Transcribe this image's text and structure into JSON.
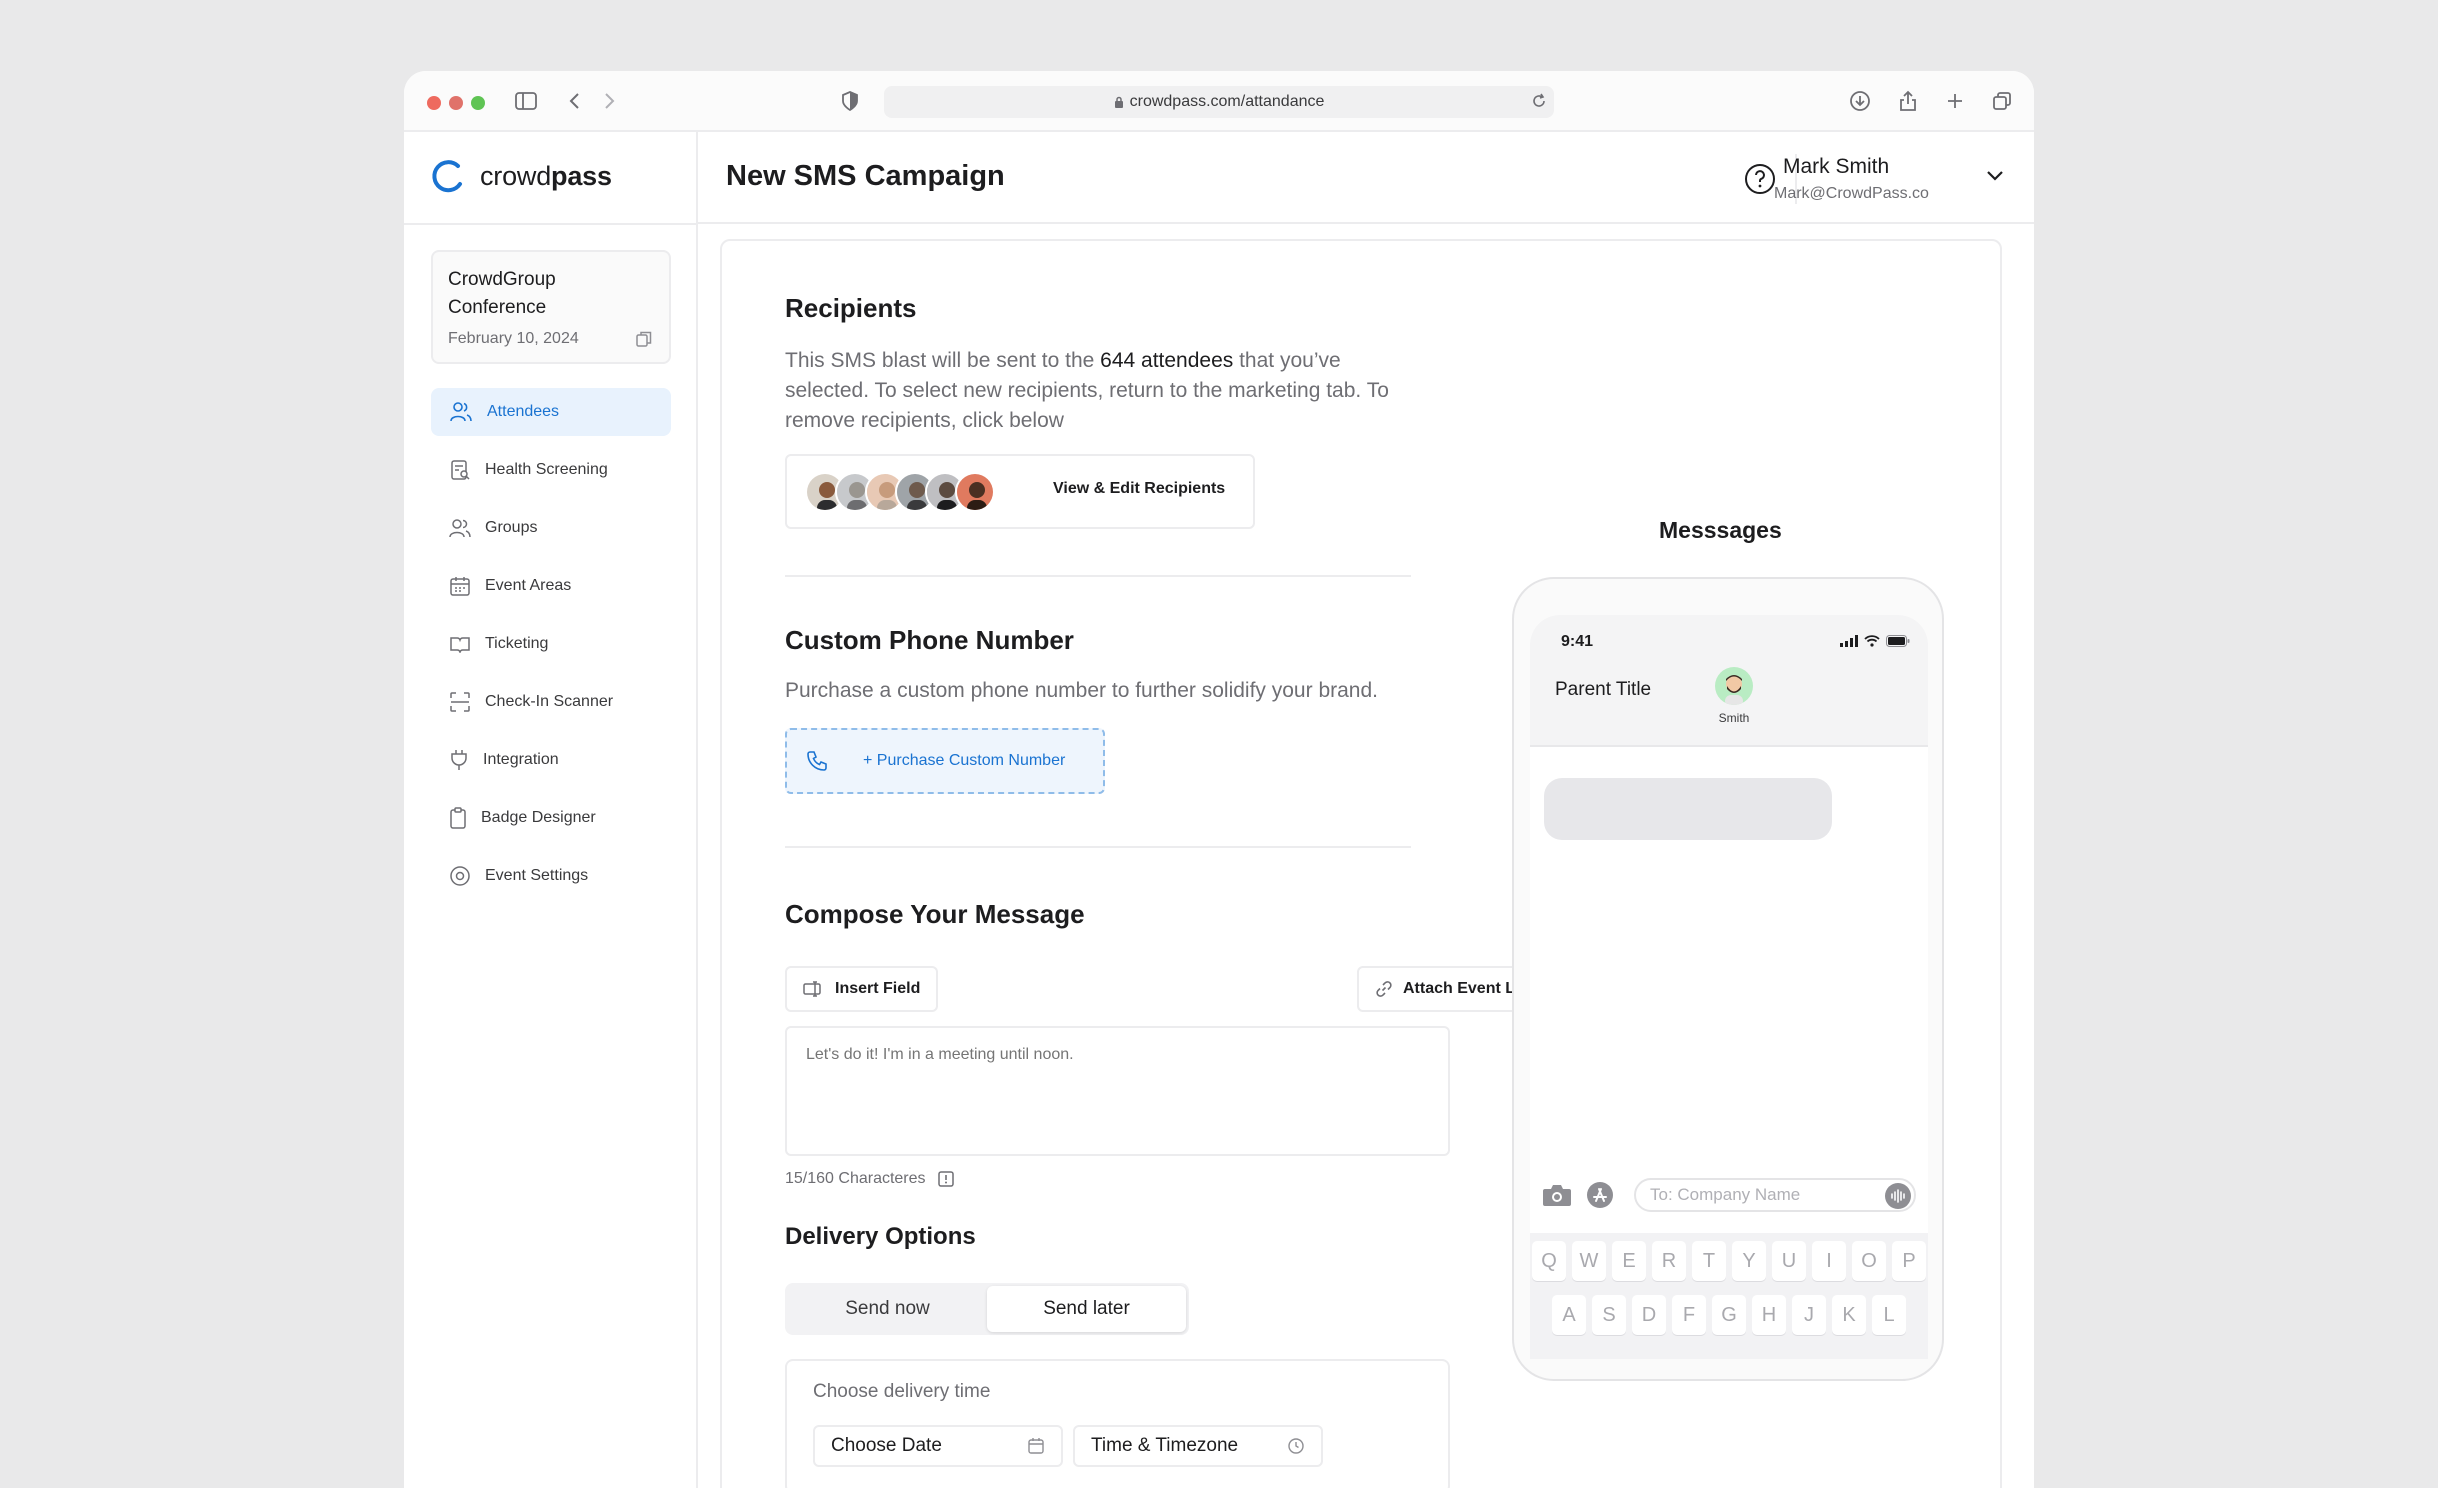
{
  "browser": {
    "url": "crowdpass.com/attandance"
  },
  "brand": {
    "name_light": "crowd",
    "name_bold": "pass",
    "accent": "#1a73d1"
  },
  "event": {
    "title": "CrowdGroup Conference",
    "date": "February 10, 2024"
  },
  "nav": [
    {
      "label": "Attendees",
      "icon": "users-icon",
      "active": true
    },
    {
      "label": "Health Screening",
      "icon": "clipboard-search-icon"
    },
    {
      "label": "Groups",
      "icon": "group-icon"
    },
    {
      "label": "Event Areas",
      "icon": "calendar-icon"
    },
    {
      "label": "Ticketing",
      "icon": "ticket-icon"
    },
    {
      "label": "Check-In Scanner",
      "icon": "scan-icon"
    },
    {
      "label": "Integration",
      "icon": "plug-icon"
    },
    {
      "label": "Badge Designer",
      "icon": "badge-icon"
    },
    {
      "label": "Event Settings",
      "icon": "settings-icon"
    }
  ],
  "header": {
    "title": "New SMS Campaign",
    "user_name": "Mark Smith",
    "user_email": "Mark@CrowdPass.co"
  },
  "recipients": {
    "title": "Recipients",
    "text_before": "This SMS blast will be sent to the ",
    "count_text": "644 attendees",
    "text_after": " that you’ve selected. To select new recipients, return to the marketing tab. To remove recipients, click below",
    "button": "View & Edit Recipients"
  },
  "phone_number": {
    "title": "Custom Phone Number",
    "text": "Purchase a custom phone number to further solidify your brand.",
    "button": "+ Purchase Custom Number"
  },
  "compose": {
    "title": "Compose Your Message",
    "insert_field": "Insert Field",
    "attach_link": "Attach Event Link",
    "placeholder": "Let's do it! I'm in a meeting until noon.",
    "counter": "15/160 Characteres"
  },
  "delivery": {
    "title": "Delivery Options",
    "options": [
      "Send now",
      "Send later"
    ],
    "selected": "Send later",
    "choose_time": "Choose delivery time",
    "date_placeholder": "Choose Date",
    "time_placeholder": "Time & Timezone"
  },
  "preview": {
    "title": "Messsages",
    "time": "9:41",
    "thread_title": "Parent Title",
    "contact": "Smith",
    "input_placeholder": "To: Company Name",
    "keys_row1": [
      "Q",
      "W",
      "E",
      "R",
      "T",
      "Y",
      "U",
      "I",
      "O",
      "P"
    ],
    "keys_row2": [
      "A",
      "S",
      "D",
      "F",
      "G",
      "H",
      "J",
      "K",
      "L"
    ]
  }
}
